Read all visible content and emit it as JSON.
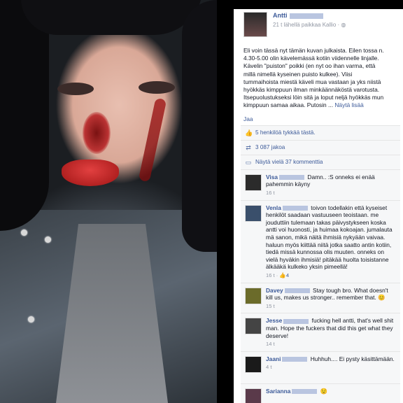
{
  "post": {
    "author": "Antti",
    "meta": "21 t lähellä paikkaa Kallio · ◍",
    "text_lines": [
      "Eli voin tässä nyt tämän kuvan julkaista. Eilen tossa n.",
      "4.30-5.00 olin kävelemässä kotiin viidennelle linjalle.",
      "Kävelin \"puiston\" poikki (en nyt oo ihan varma, että",
      "millä nimellä kyseinen puisto kulkee). Viisi",
      "tummaihoista miestä käveli mua vastaan ja yks niistä",
      "hyökkäs kimppuun ilman minkäännäköstä varotusta.",
      "Itsepuolustukseksi löin sitä ja loput neljä hyökkäs mun",
      "kimppuun samaa aikaa. Putosin ..."
    ],
    "see_more": "Näytä lisää",
    "action_like": "Jaa",
    "likes": "5 henkilöä tykkää tästä.",
    "shares": "3 087 jakoa",
    "view_comments": "Näytä vielä 37 kommenttia"
  },
  "comments": [
    {
      "name": "Visa",
      "text": "Damn.. :S onneks ei enää pahemmin käyny",
      "time": "16 t",
      "likes": ""
    },
    {
      "name": "Venla",
      "text": "toivon todellakin että kyseiset henkilöt saadaan vastuuseen teoistaan. me jouduttiin tulemaan takas päivystykseen koska antti voi huonosti, ja huimaa kokoajan. jumalauta mä sanon, mikä näitä ihmisiä nykyään vaivaa. haluun myös kiittää niitä jotka saatto antin kotiin, tiedä missä kunnossa olis muuten. onneks on vielä hyväkin ihmisiä! pitäkää huolta toisistanne älkääkä kulkeko yksin pimeellä!",
      "time": "16 t",
      "likes": "4"
    },
    {
      "name": "Davey",
      "text": "Stay tough bro. What doesn't kill us, makes us stronger.. remember that. 😊",
      "time": "15 t",
      "likes": ""
    },
    {
      "name": "Jesse",
      "text": "fucking hell antti, that's well shit man. Hope the fuckers that did this get what they deserve!",
      "time": "14 t",
      "likes": ""
    },
    {
      "name": "Jaani",
      "text": "Huhhuh.... Ei pysty käsittämään.",
      "time": "4 t",
      "likes": ""
    },
    {
      "name": "Sarianna",
      "text": "😟",
      "time": "",
      "likes": ""
    }
  ],
  "colors": {
    "link": "#3b5998",
    "meta": "#9197a3",
    "panel": "#f6f7f8"
  }
}
